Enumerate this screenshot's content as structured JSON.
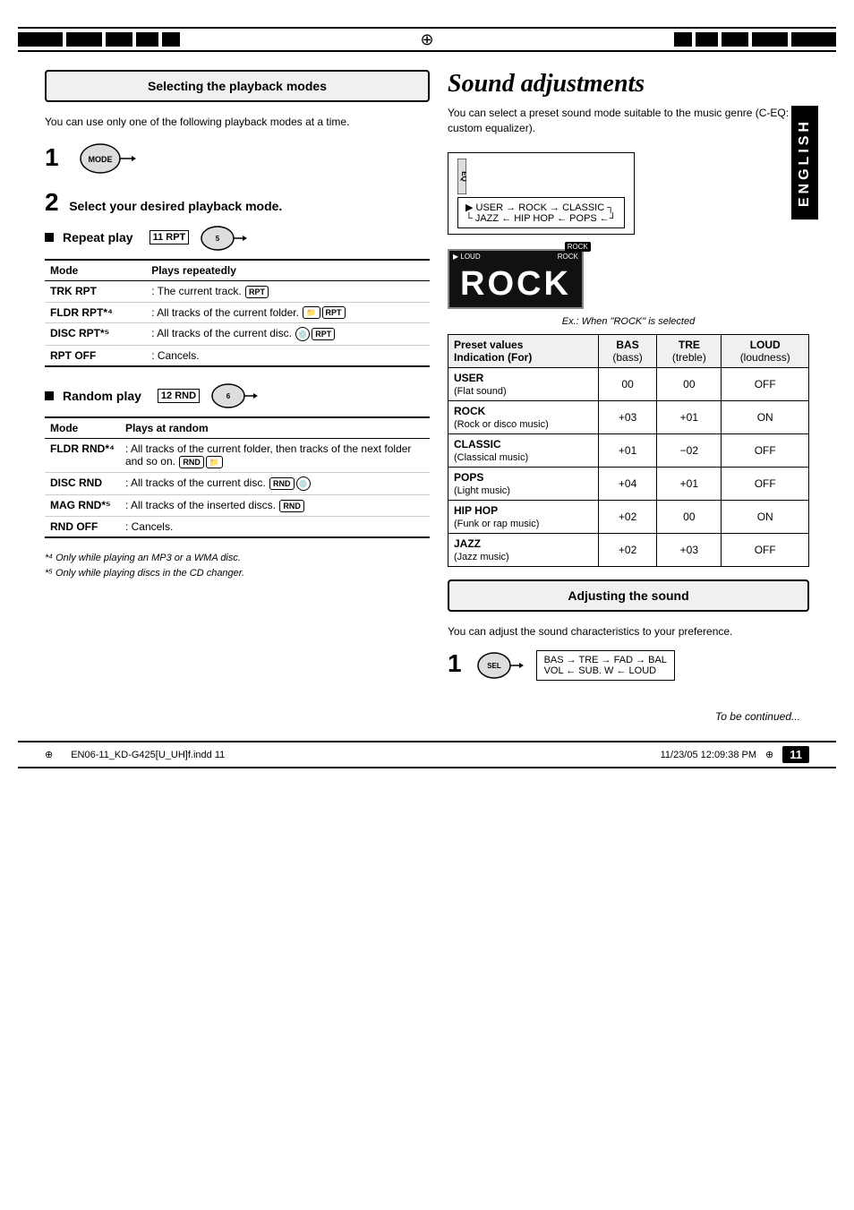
{
  "page": {
    "number": "11",
    "filename": "EN06-11_KD-G425[U_UH]f.indd  11",
    "date": "11/23/05  12:09:38 PM"
  },
  "left_section": {
    "title": "Selecting the playback modes",
    "description": "You can use only one of the following playback modes at a time.",
    "step1_label": "1",
    "step2_label": "2",
    "step2_instruction": "Select your desired playback mode.",
    "repeat_play": {
      "header": "Repeat play",
      "table_headers": [
        "Mode",
        "Plays repeatedly"
      ],
      "rows": [
        {
          "mode": "TRK RPT",
          "desc": ": The current track. ",
          "badges": [
            "RPT"
          ]
        },
        {
          "mode": "FLDR RPT*⁴",
          "desc": ": All tracks of the current folder. ",
          "badges": [
            "folder",
            "RPT"
          ]
        },
        {
          "mode": "DISC RPT*⁵",
          "desc": ": All tracks of the current disc.",
          "badges": [
            "disc",
            "RPT"
          ]
        },
        {
          "mode": "RPT OFF",
          "desc": ": Cancels.",
          "badges": []
        }
      ]
    },
    "random_play": {
      "header": "Random play",
      "table_headers": [
        "Mode",
        "Plays at random"
      ],
      "rows": [
        {
          "mode": "FLDR RND*⁴",
          "desc": ": All tracks of the current folder, then tracks of the next folder and so on. ",
          "badges": [
            "RND",
            "folder"
          ]
        },
        {
          "mode": "DISC RND",
          "desc": ": All tracks of the current disc.",
          "badges": [
            "RND",
            "disc"
          ]
        },
        {
          "mode": "MAG RND*⁵",
          "desc": ": All tracks of the inserted discs.",
          "badges": [
            "RND"
          ]
        },
        {
          "mode": "RND OFF",
          "desc": ": Cancels.",
          "badges": []
        }
      ]
    },
    "footnotes": [
      "*⁴  Only while playing an MP3 or a WMA disc.",
      "*⁵  Only while playing discs in the CD changer."
    ]
  },
  "right_section": {
    "title": "Sound adjustments",
    "description": "You can select a preset sound mode suitable to the music genre (C-EQ: custom equalizer).",
    "eq_sequence": "USER → ROCK → CLASSIC → JAZZ ← HIP HOP ← POPS",
    "rock_display": "ROCK",
    "rock_caption": "Ex.: When \"ROCK\" is selected",
    "preset_table": {
      "headers": [
        "Preset values",
        "BAS (bass)",
        "TRE (treble)",
        "LOUD (loudness)"
      ],
      "indication_label": "Indication (For)",
      "rows": [
        {
          "name": "USER",
          "sub": "(Flat sound)",
          "bas": "00",
          "tre": "00",
          "loud": "OFF"
        },
        {
          "name": "ROCK",
          "sub": "(Rock or disco music)",
          "bas": "+03",
          "tre": "+01",
          "loud": "ON"
        },
        {
          "name": "CLASSIC",
          "sub": "(Classical music)",
          "bas": "+01",
          "tre": "–02",
          "loud": "OFF"
        },
        {
          "name": "POPS",
          "sub": "(Light music)",
          "bas": "+04",
          "tre": "+01",
          "loud": "OFF"
        },
        {
          "name": "HIP HOP",
          "sub": "(Funk or rap music)",
          "bas": "+02",
          "tre": "00",
          "loud": "ON"
        },
        {
          "name": "JAZZ",
          "sub": "(Jazz music)",
          "bas": "+02",
          "tre": "+03",
          "loud": "OFF"
        }
      ]
    },
    "adjusting_sound": {
      "title": "Adjusting the sound",
      "description": "You can adjust the sound characteristics to your preference.",
      "step1_label": "1",
      "sel_sequence_line1": "BAS → TRE → FAD → BAL",
      "sel_sequence_line2": "VOL ← SUB. W ← LOUD"
    }
  },
  "sidebar": {
    "language": "ENGLISH"
  },
  "footer": {
    "to_be_continued": "To be continued..."
  }
}
